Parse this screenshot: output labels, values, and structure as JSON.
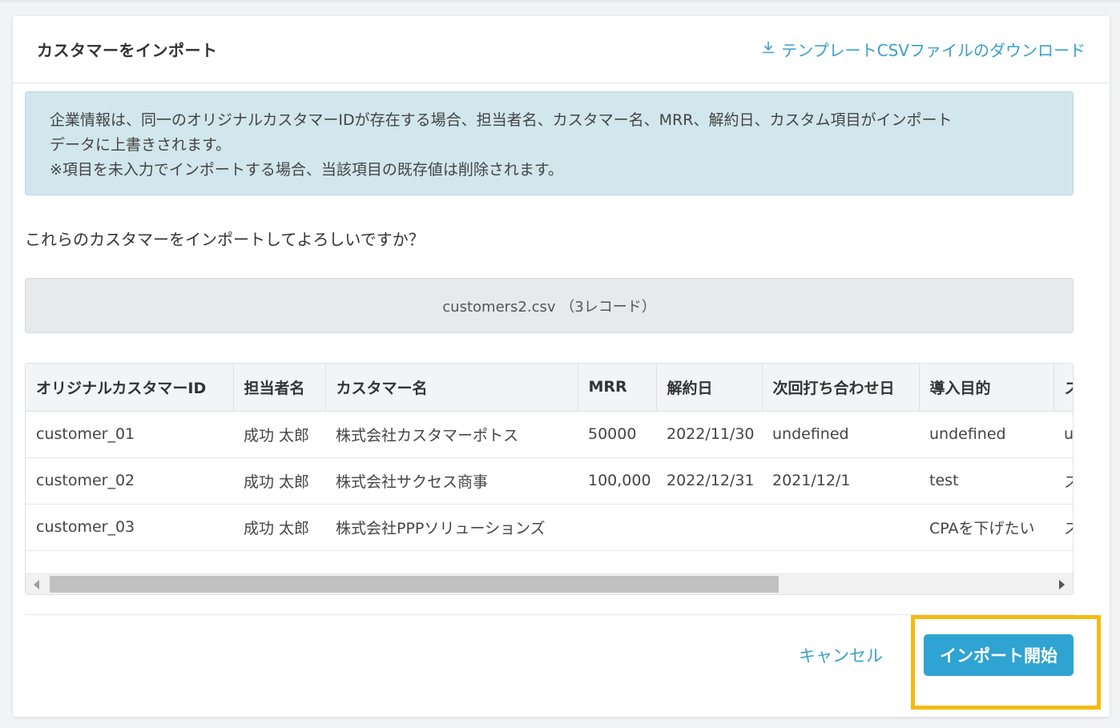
{
  "modal": {
    "title": "カスタマーをインポート",
    "download_link": "テンプレートCSVファイルのダウンロード"
  },
  "info": {
    "line1": "企業情報は、同一のオリジナルカスタマーIDが存在する場合、担当者名、カスタマー名、MRR、解約日、カスタム項目がインポート",
    "line2": "データに上書きされます。",
    "line3": "※項目を未入力でインポートする場合、当該項目の既存値は削除されます。"
  },
  "question": "これらのカスタマーをインポートしてよろしいですか？",
  "file": {
    "label": "customers2.csv （3レコード）"
  },
  "table": {
    "headers": [
      "オリジナルカスタマーID",
      "担当者名",
      "カスタマー名",
      "MRR",
      "解約日",
      "次回打ち合わせ日",
      "導入目的",
      "ス"
    ],
    "rows": [
      [
        "customer_01",
        "成功 太郎",
        "株式会社カスタマーポトス",
        "50000",
        "2022/11/30",
        "undefined",
        "undefined",
        "u"
      ],
      [
        "customer_02",
        "成功 太郎",
        "株式会社サクセス商事",
        "100,000",
        "2022/12/31",
        "2021/12/1",
        "test",
        "ス"
      ],
      [
        "customer_03",
        "成功 太郎",
        "株式会社PPPソリューションズ",
        "",
        "",
        "",
        "CPAを下げたい",
        "ス"
      ]
    ]
  },
  "footer": {
    "cancel": "キャンセル",
    "import": "インポート開始"
  },
  "colors": {
    "accent": "#2fa3d1",
    "link": "#3aa0c9",
    "info_bg": "#d2e6ed",
    "highlight": "#f4bb0f"
  },
  "icons": {
    "download": "download-icon"
  }
}
